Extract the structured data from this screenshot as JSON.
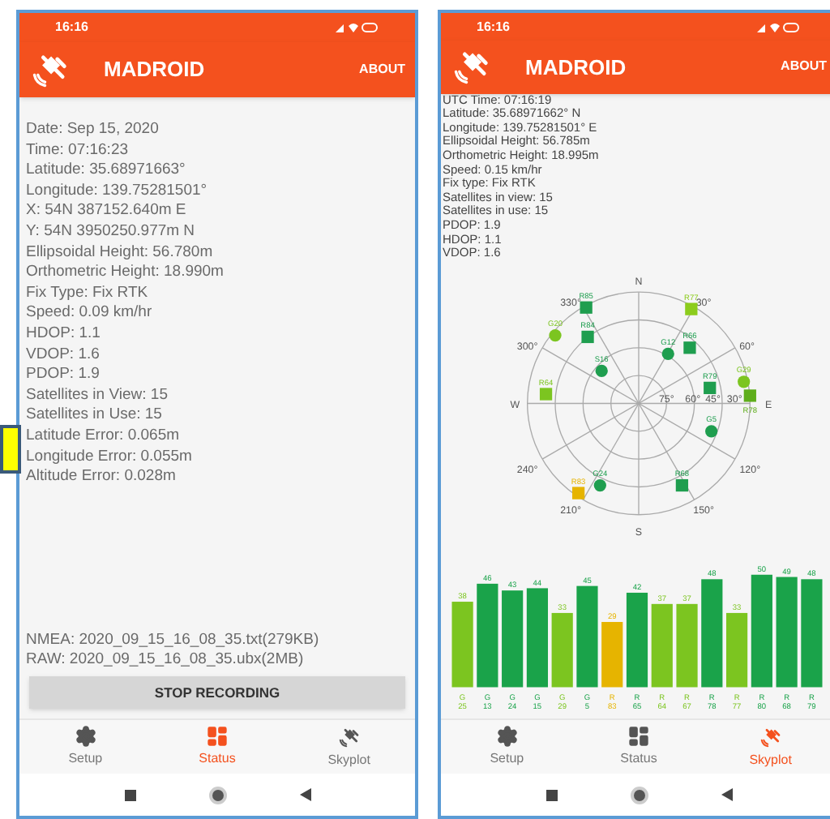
{
  "phones": [
    {
      "status_bar": {
        "time": "16:16"
      },
      "app_bar": {
        "title": "MADROID",
        "action": "ABOUT"
      },
      "lines": [
        "Date: Sep 15, 2020",
        "Time: 07:16:23",
        "Latitude: 35.68971663°",
        "Longitude: 139.75281501°",
        "X: 54N 387152.640m E",
        "Y: 54N 3950250.977m N",
        "Ellipsoidal Height: 56.780m",
        "Orthometric Height: 18.990m",
        "Fix Type: Fix RTK",
        "Speed: 0.09 km/hr",
        "HDOP: 1.1",
        "VDOP: 1.6",
        "PDOP: 1.9",
        "Satellites in View: 15",
        "Satellites in Use: 15",
        "Latitude Error: 0.065m",
        "Longitude Error: 0.055m",
        "Altitude Error: 0.028m"
      ],
      "files": [
        "NMEA: 2020_09_15_16_08_35.txt(279KB)",
        "RAW: 2020_09_15_16_08_35.ubx(2MB)"
      ],
      "button": "STOP RECORDING",
      "nav": [
        {
          "label": "Setup",
          "selected": false
        },
        {
          "label": "Status",
          "selected": true
        },
        {
          "label": "Skyplot",
          "selected": false
        }
      ]
    },
    {
      "status_bar": {
        "time": "16:16"
      },
      "app_bar": {
        "title": "MADROID",
        "action": "ABOUT"
      },
      "lines": [
        "UTC Time: 07:16:19",
        "Latitude: 35.68971662° N",
        "Longitude: 139.75281501° E",
        "Ellipsoidal Height: 56.785m",
        "Orthometric Height: 18.995m",
        "Speed: 0.15 km/hr",
        "Fix type: Fix RTK",
        "Satellites in view: 15",
        "Satellites in use: 15",
        "PDOP: 1.9",
        "HDOP: 1.1",
        "VDOP: 1.6"
      ],
      "skyplot": {
        "ticks": [
          "N",
          "E",
          "S",
          "W",
          "330°",
          "30°",
          "300°",
          "60°",
          "240°",
          "120°",
          "210°",
          "150°",
          "75°",
          "60°",
          "45°",
          "30°"
        ],
        "satellites": [
          {
            "label": "R85",
            "kind": "square",
            "color": "#1f9e4f"
          },
          {
            "label": "G20",
            "kind": "circle",
            "color": "#7cc520"
          },
          {
            "label": "R84",
            "kind": "square",
            "color": "#1f9e4f"
          },
          {
            "label": "S16",
            "kind": "circle",
            "color": "#1f9e4f"
          },
          {
            "label": "G12",
            "kind": "circle",
            "color": "#1f9e4f"
          },
          {
            "label": "R66",
            "kind": "square",
            "color": "#1f9e4f"
          },
          {
            "label": "R77",
            "kind": "square",
            "color": "#8ccc1c"
          },
          {
            "label": "G29",
            "kind": "circle",
            "color": "#7cc520"
          },
          {
            "label": "R78",
            "kind": "square",
            "color": "#5fae1c"
          },
          {
            "label": "R79",
            "kind": "square",
            "color": "#1f9e4f"
          },
          {
            "label": "G5",
            "kind": "circle",
            "color": "#1f9e4f"
          },
          {
            "label": "R68",
            "kind": "square",
            "color": "#1f9e4f"
          },
          {
            "label": "G24",
            "kind": "circle",
            "color": "#1f9e4f"
          },
          {
            "label": "R83",
            "kind": "square",
            "color": "#e6b400"
          },
          {
            "label": "R64",
            "kind": "square",
            "color": "#7cc520"
          }
        ]
      },
      "chart_data": {
        "type": "bar",
        "data_labels": true,
        "categories": [
          "G 25",
          "G 13",
          "G 24",
          "G 15",
          "G 29",
          "G 5",
          "R 83",
          "R 65",
          "R 64",
          "R 67",
          "R 78",
          "R 77",
          "R 80",
          "R 68",
          "R 79"
        ],
        "series": [
          {
            "color": "#1aa34a",
            "values": [
              null,
              46,
              43,
              44,
              null,
              45,
              null,
              42,
              null,
              null,
              48,
              null,
              50,
              49,
              48
            ]
          },
          {
            "color": "#7cc520",
            "values": [
              38,
              null,
              null,
              null,
              33,
              null,
              null,
              null,
              37,
              37,
              null,
              33,
              null,
              null,
              null
            ]
          },
          {
            "color": "#e6b400",
            "values": [
              null,
              null,
              null,
              null,
              null,
              null,
              29,
              null,
              null,
              null,
              null,
              null,
              null,
              null,
              null
            ]
          }
        ]
      },
      "nav": [
        {
          "label": "Setup",
          "selected": false
        },
        {
          "label": "Status",
          "selected": false
        },
        {
          "label": "Skyplot",
          "selected": true
        }
      ]
    }
  ]
}
